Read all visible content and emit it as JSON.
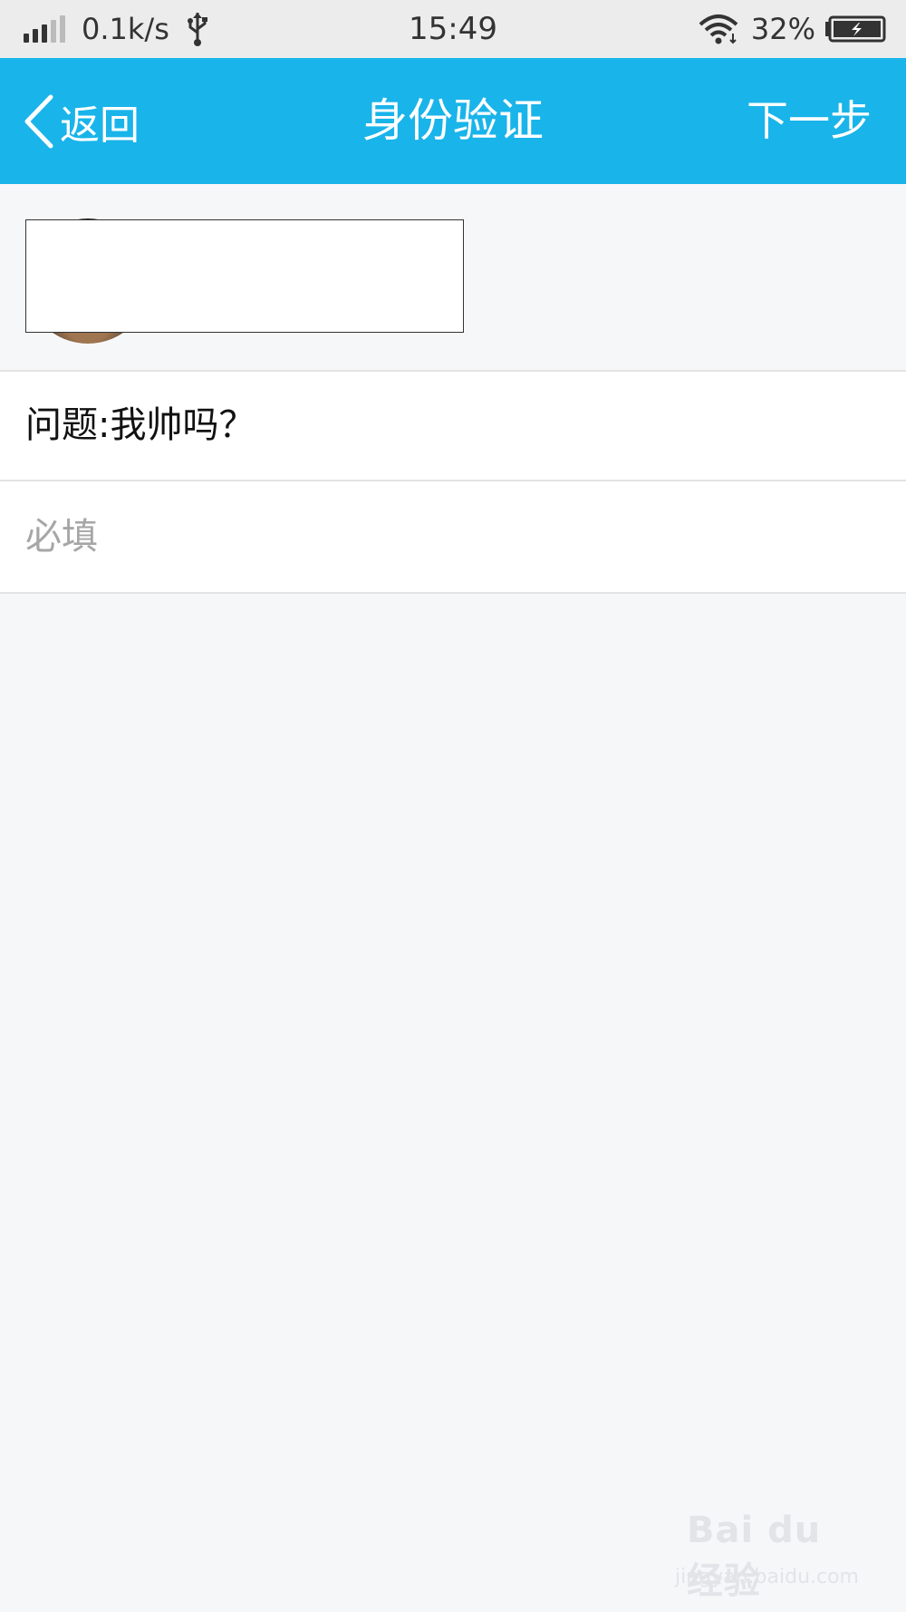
{
  "status_bar": {
    "net_speed": "0.1k/s",
    "time": "15:49",
    "battery_percent": "32%",
    "signal_bars_active": 3,
    "signal_bars_total": 5,
    "icons": [
      "signal-icon",
      "usb-icon",
      "wifi-icon",
      "battery-charging-icon"
    ]
  },
  "header": {
    "back_label": "返回",
    "title": "身份验证",
    "next_label": "下一步",
    "background_color": "#19b4ea"
  },
  "form": {
    "question": "问题:我帅吗？",
    "answer_value": "",
    "answer_placeholder": "必填"
  },
  "watermark": {
    "logo": "Bai du 经验",
    "url": "jingyan.baidu.com"
  }
}
